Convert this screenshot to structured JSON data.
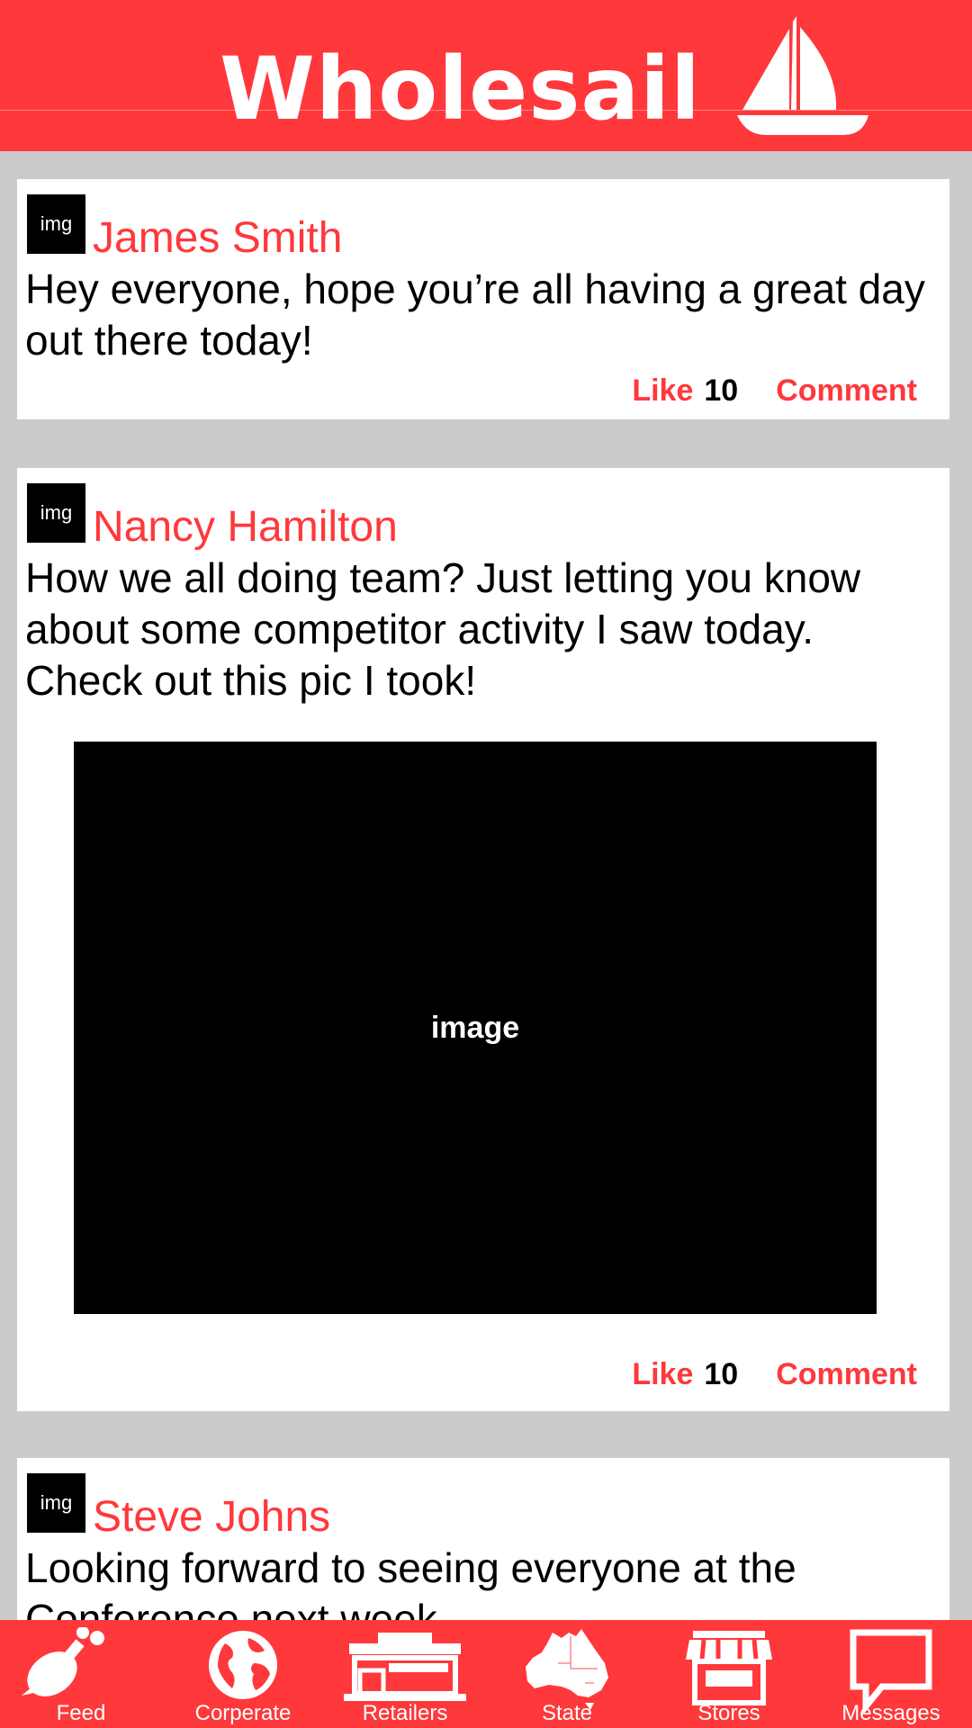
{
  "app": {
    "title": "Wholesail"
  },
  "posts": [
    {
      "avatar_text": "img",
      "author": "James Smith",
      "text": "Hey everyone, hope you’re all having a great day out there today!",
      "like_label": "Like",
      "like_count": "10",
      "comment_label": "Comment"
    },
    {
      "avatar_text": "img",
      "author": "Nancy Hamilton",
      "text": "How we all doing team? Just letting you know about some competitor activity I saw today. Check out this pic I took!",
      "image_label": "image",
      "like_label": "Like",
      "like_count": "10",
      "comment_label": "Comment"
    },
    {
      "avatar_text": "img",
      "author": "Steve Johns",
      "text": "Looking forward to seeing everyone at the Conference next week."
    }
  ],
  "nav": {
    "items": [
      {
        "label": "Feed",
        "icon": "chicken-leg-icon"
      },
      {
        "label": "Corperate",
        "icon": "globe-icon"
      },
      {
        "label": "Retailers",
        "icon": "building-icon"
      },
      {
        "label": "State",
        "icon": "australia-map-icon"
      },
      {
        "label": "Stores",
        "icon": "storefront-icon"
      },
      {
        "label": "Messages",
        "icon": "speech-bubble-icon"
      }
    ]
  },
  "colors": {
    "accent": "#ff383b",
    "background": "#cbcbcb"
  }
}
